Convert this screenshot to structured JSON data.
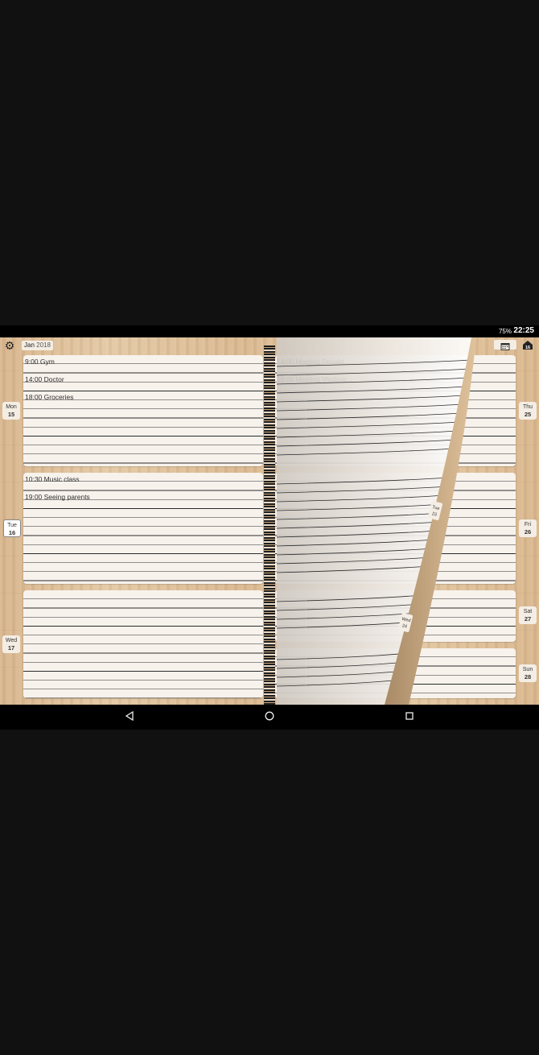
{
  "status": {
    "battery": "75%",
    "time": "22:25"
  },
  "header": {
    "month": "Jan",
    "year": "2018",
    "calendar_icon": "calendar-icon",
    "today_icon": "today-icon",
    "today_num": "16",
    "settings_icon": "gear-icon"
  },
  "days_left": [
    {
      "day": "Mon",
      "num": "15",
      "entries": [
        "9:00 Gym",
        "14:00 Doctor",
        "18:00 Groceries"
      ]
    },
    {
      "day": "Tue",
      "num": "16",
      "entries": [
        "10:30 Music class",
        "19:00 Seeing parents"
      ]
    },
    {
      "day": "Wed",
      "num": "17",
      "entries": []
    }
  ],
  "days_right": [
    {
      "day": "Thu",
      "num": "25",
      "entries": [
        "14:00 Meeting Donald",
        "18:00 Meeting Vladimir"
      ]
    },
    {
      "day": "Fri",
      "num": "26",
      "entries": []
    },
    {
      "day": "Sat",
      "num": "27",
      "entries": []
    },
    {
      "day": "Sun",
      "num": "28",
      "entries": []
    }
  ],
  "curl_tabs": [
    {
      "day": "Tue",
      "num": "23"
    },
    {
      "day": "Wed",
      "num": "24"
    }
  ],
  "nav": {
    "back_icon": "back-icon",
    "home_icon": "home-icon",
    "recents_icon": "recents-icon"
  }
}
